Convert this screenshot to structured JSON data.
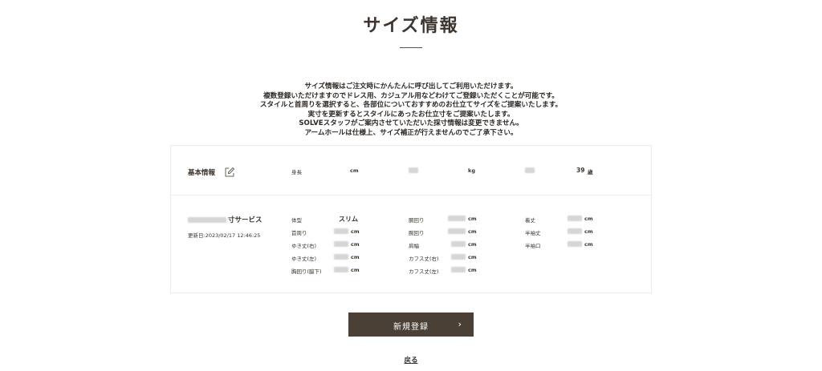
{
  "page": {
    "title": "サイズ情報",
    "intro": [
      "サイズ情報はご注文時にかんたんに呼び出してご利用いただけます。",
      "複数登録いただけますのでドレス用、カジュアル用などわけてご登録いただくことが可能です。",
      "スタイルと首周りを選択すると、各部位についておすすめのお仕立てサイズをご提案いたします。",
      "実寸を更新するとスタイルにあったお仕立寸をご提案いたします。",
      "SOLVEスタッフがご案内させていただいた採寸情報は変更できません。",
      "アームホールは仕様上、サイズ補正が行えませんのでご了承下さい。"
    ]
  },
  "basic": {
    "label": "基本情報",
    "edit_icon": "edit-icon",
    "height_label": "身長",
    "height_unit": "cm",
    "weight_unit": "kg",
    "age_value": "39",
    "age_unit": "歳"
  },
  "service": {
    "name_suffix": "寸サービス",
    "updated": "更新日:2023/02/17 12:46:25",
    "body_type_label": "体型",
    "body_type_value": "スリム",
    "col1": [
      "首周り",
      "ゆき丈(右)",
      "ゆき丈(左)",
      "胸回り(脇下)"
    ],
    "col2": [
      "胴回り",
      "腕回り",
      "肩幅",
      "カフス丈(右)",
      "カフス丈(左)"
    ],
    "col3": [
      "着丈",
      "半袖丈",
      "半袖口"
    ],
    "unit": "cm"
  },
  "actions": {
    "new_button": "新規登録",
    "new_chevron": "›",
    "back_link": "戻る"
  },
  "colors": {
    "button_bg": "#4b4036",
    "text": "#3a332c"
  }
}
